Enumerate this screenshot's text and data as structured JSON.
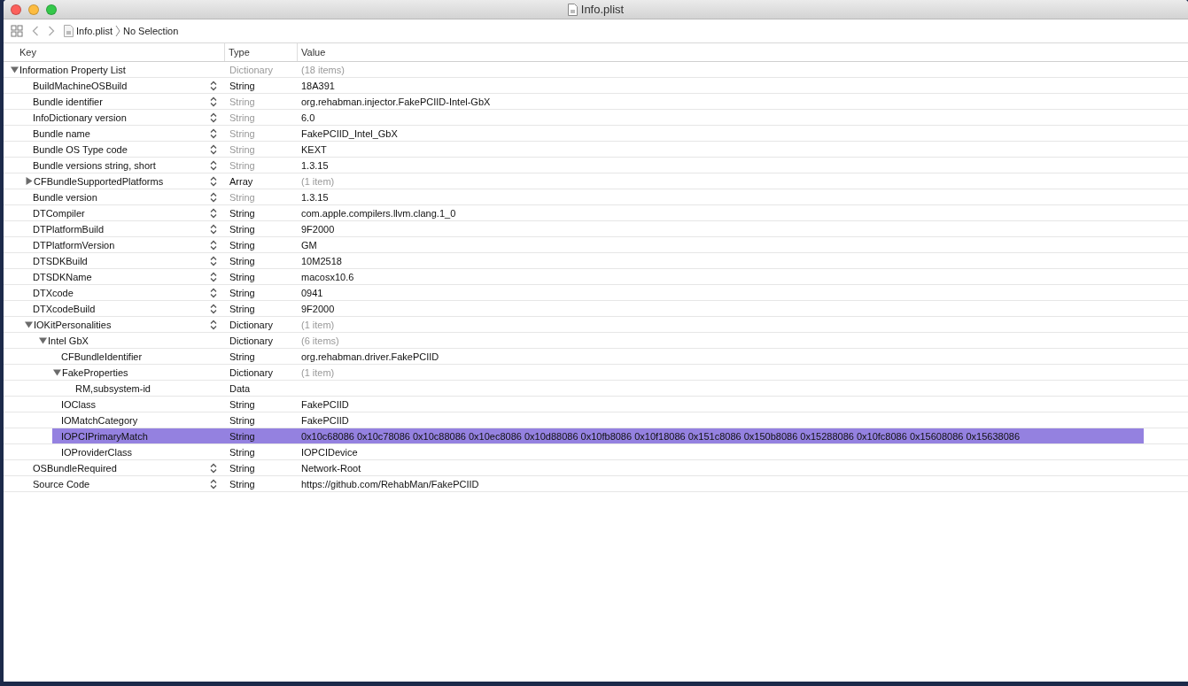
{
  "window": {
    "title": "Info.plist"
  },
  "toolbar": {
    "breadcrumbs": [
      "Info.plist",
      "No Selection"
    ]
  },
  "table": {
    "columns": [
      "Key",
      "Type",
      "Value"
    ],
    "rows": [
      {
        "key": "Information Property List",
        "type": "Dictionary",
        "value": "(18 items)",
        "type_dimmed": true,
        "value_dimmed": true,
        "expanded": true,
        "selected": false,
        "children": [
          {
            "key": "BuildMachineOSBuild",
            "type": "String",
            "value": "18A391",
            "type_dimmed": false,
            "value_dimmed": false,
            "selected": false
          },
          {
            "key": "Bundle identifier",
            "type": "String",
            "value": "org.rehabman.injector.FakePCIID-Intel-GbX",
            "type_dimmed": true,
            "value_dimmed": false,
            "selected": false
          },
          {
            "key": "InfoDictionary version",
            "type": "String",
            "value": "6.0",
            "type_dimmed": true,
            "value_dimmed": false,
            "selected": false
          },
          {
            "key": "Bundle name",
            "type": "String",
            "value": "FakePCIID_Intel_GbX",
            "type_dimmed": true,
            "value_dimmed": false,
            "selected": false
          },
          {
            "key": "Bundle OS Type code",
            "type": "String",
            "value": "KEXT",
            "type_dimmed": true,
            "value_dimmed": false,
            "selected": false
          },
          {
            "key": "Bundle versions string, short",
            "type": "String",
            "value": "1.3.15",
            "type_dimmed": true,
            "value_dimmed": false,
            "selected": false
          },
          {
            "key": "CFBundleSupportedPlatforms",
            "type": "Array",
            "value": "(1 item)",
            "type_dimmed": false,
            "value_dimmed": true,
            "expanded": false,
            "selected": false
          },
          {
            "key": "Bundle version",
            "type": "String",
            "value": "1.3.15",
            "type_dimmed": true,
            "value_dimmed": false,
            "selected": false
          },
          {
            "key": "DTCompiler",
            "type": "String",
            "value": "com.apple.compilers.llvm.clang.1_0",
            "type_dimmed": false,
            "value_dimmed": false,
            "selected": false
          },
          {
            "key": "DTPlatformBuild",
            "type": "String",
            "value": "9F2000",
            "type_dimmed": false,
            "value_dimmed": false,
            "selected": false
          },
          {
            "key": "DTPlatformVersion",
            "type": "String",
            "value": "GM",
            "type_dimmed": false,
            "value_dimmed": false,
            "selected": false
          },
          {
            "key": "DTSDKBuild",
            "type": "String",
            "value": "10M2518",
            "type_dimmed": false,
            "value_dimmed": false,
            "selected": false
          },
          {
            "key": "DTSDKName",
            "type": "String",
            "value": "macosx10.6",
            "type_dimmed": false,
            "value_dimmed": false,
            "selected": false
          },
          {
            "key": "DTXcode",
            "type": "String",
            "value": "0941",
            "type_dimmed": false,
            "value_dimmed": false,
            "selected": false
          },
          {
            "key": "DTXcodeBuild",
            "type": "String",
            "value": "9F2000",
            "type_dimmed": false,
            "value_dimmed": false,
            "selected": false
          },
          {
            "key": "IOKitPersonalities",
            "type": "Dictionary",
            "value": "(1 item)",
            "type_dimmed": false,
            "value_dimmed": true,
            "expanded": true,
            "selected": false,
            "children": [
              {
                "key": "Intel GbX",
                "type": "Dictionary",
                "value": "(6 items)",
                "type_dimmed": false,
                "value_dimmed": true,
                "expanded": true,
                "selected": false,
                "children": [
                  {
                    "key": "CFBundleIdentifier",
                    "type": "String",
                    "value": "org.rehabman.driver.FakePCIID",
                    "type_dimmed": false,
                    "value_dimmed": false,
                    "selected": false
                  },
                  {
                    "key": "FakeProperties",
                    "type": "Dictionary",
                    "value": "(1 item)",
                    "type_dimmed": false,
                    "value_dimmed": true,
                    "expanded": true,
                    "selected": false,
                    "children": [
                      {
                        "key": "RM,subsystem-id",
                        "type": "Data",
                        "type_dimmed": false,
                        "selected": false
                      }
                    ]
                  },
                  {
                    "key": "IOClass",
                    "type": "String",
                    "value": "FakePCIID",
                    "type_dimmed": false,
                    "value_dimmed": false,
                    "selected": false
                  },
                  {
                    "key": "IOMatchCategory",
                    "type": "String",
                    "value": "FakePCIID",
                    "type_dimmed": false,
                    "value_dimmed": false,
                    "selected": false
                  },
                  {
                    "key": "IOPCIPrimaryMatch",
                    "type": "String",
                    "value": "0x10c68086 0x10c78086 0x10c88086 0x10ec8086 0x10d88086 0x10fb8086 0x10f18086 0x151c8086 0x150b8086 0x15288086 0x10fc8086 0x15608086 0x15638086",
                    "type_dimmed": false,
                    "value_dimmed": false,
                    "selected": true
                  },
                  {
                    "key": "IOProviderClass",
                    "type": "String",
                    "value": "IOPCIDevice",
                    "type_dimmed": false,
                    "value_dimmed": false,
                    "selected": false
                  }
                ]
              }
            ]
          },
          {
            "key": "OSBundleRequired",
            "type": "String",
            "value": "Network-Root",
            "type_dimmed": false,
            "value_dimmed": false,
            "selected": false
          },
          {
            "key": "Source Code",
            "type": "String",
            "value": "https://github.com/RehabMan/FakePCIID",
            "type_dimmed": false,
            "value_dimmed": false,
            "selected": false
          }
        ]
      }
    ]
  }
}
